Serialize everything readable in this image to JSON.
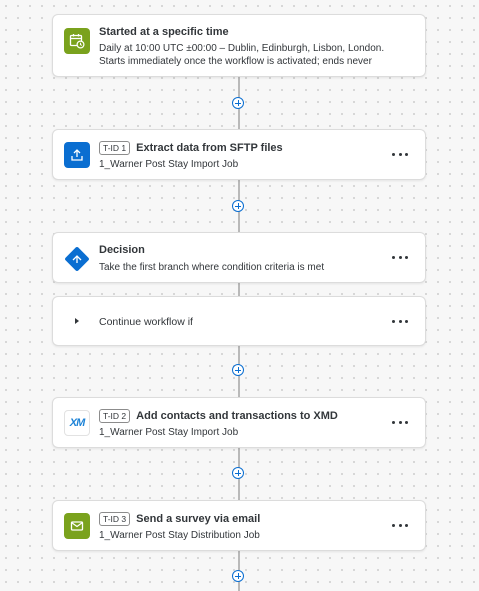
{
  "trigger": {
    "title": "Started at a specific time",
    "line1": "Daily at 10:00 UTC ±00:00 – Dublin, Edinburgh, Lisbon, London.",
    "line2": "Starts immediately once the workflow is activated; ends never",
    "icon": "calendar-clock-icon"
  },
  "steps": [
    {
      "tid": "T-ID 1",
      "title": "Extract data from SFTP files",
      "subtitle": "1_Warner Post Stay Import Job",
      "icon": "upload-icon"
    },
    {
      "tid": "T-ID 2",
      "title": "Add contacts and transactions to XMD",
      "subtitle": "1_Warner Post Stay Import Job",
      "icon": "xm-logo-icon"
    },
    {
      "tid": "T-ID 3",
      "title": "Send a survey via email",
      "subtitle": "1_Warner Post Stay Distribution Job",
      "icon": "email-icon"
    }
  ],
  "decision": {
    "title": "Decision",
    "subtitle": "Take the first branch where condition criteria is met",
    "icon": "decision-icon"
  },
  "branch": {
    "label": "Continue workflow if"
  },
  "xm_logo_text": "XM",
  "colors": {
    "green": "#7aa21d",
    "blue": "#0a6ed1",
    "connector": "#b9b9b9"
  }
}
